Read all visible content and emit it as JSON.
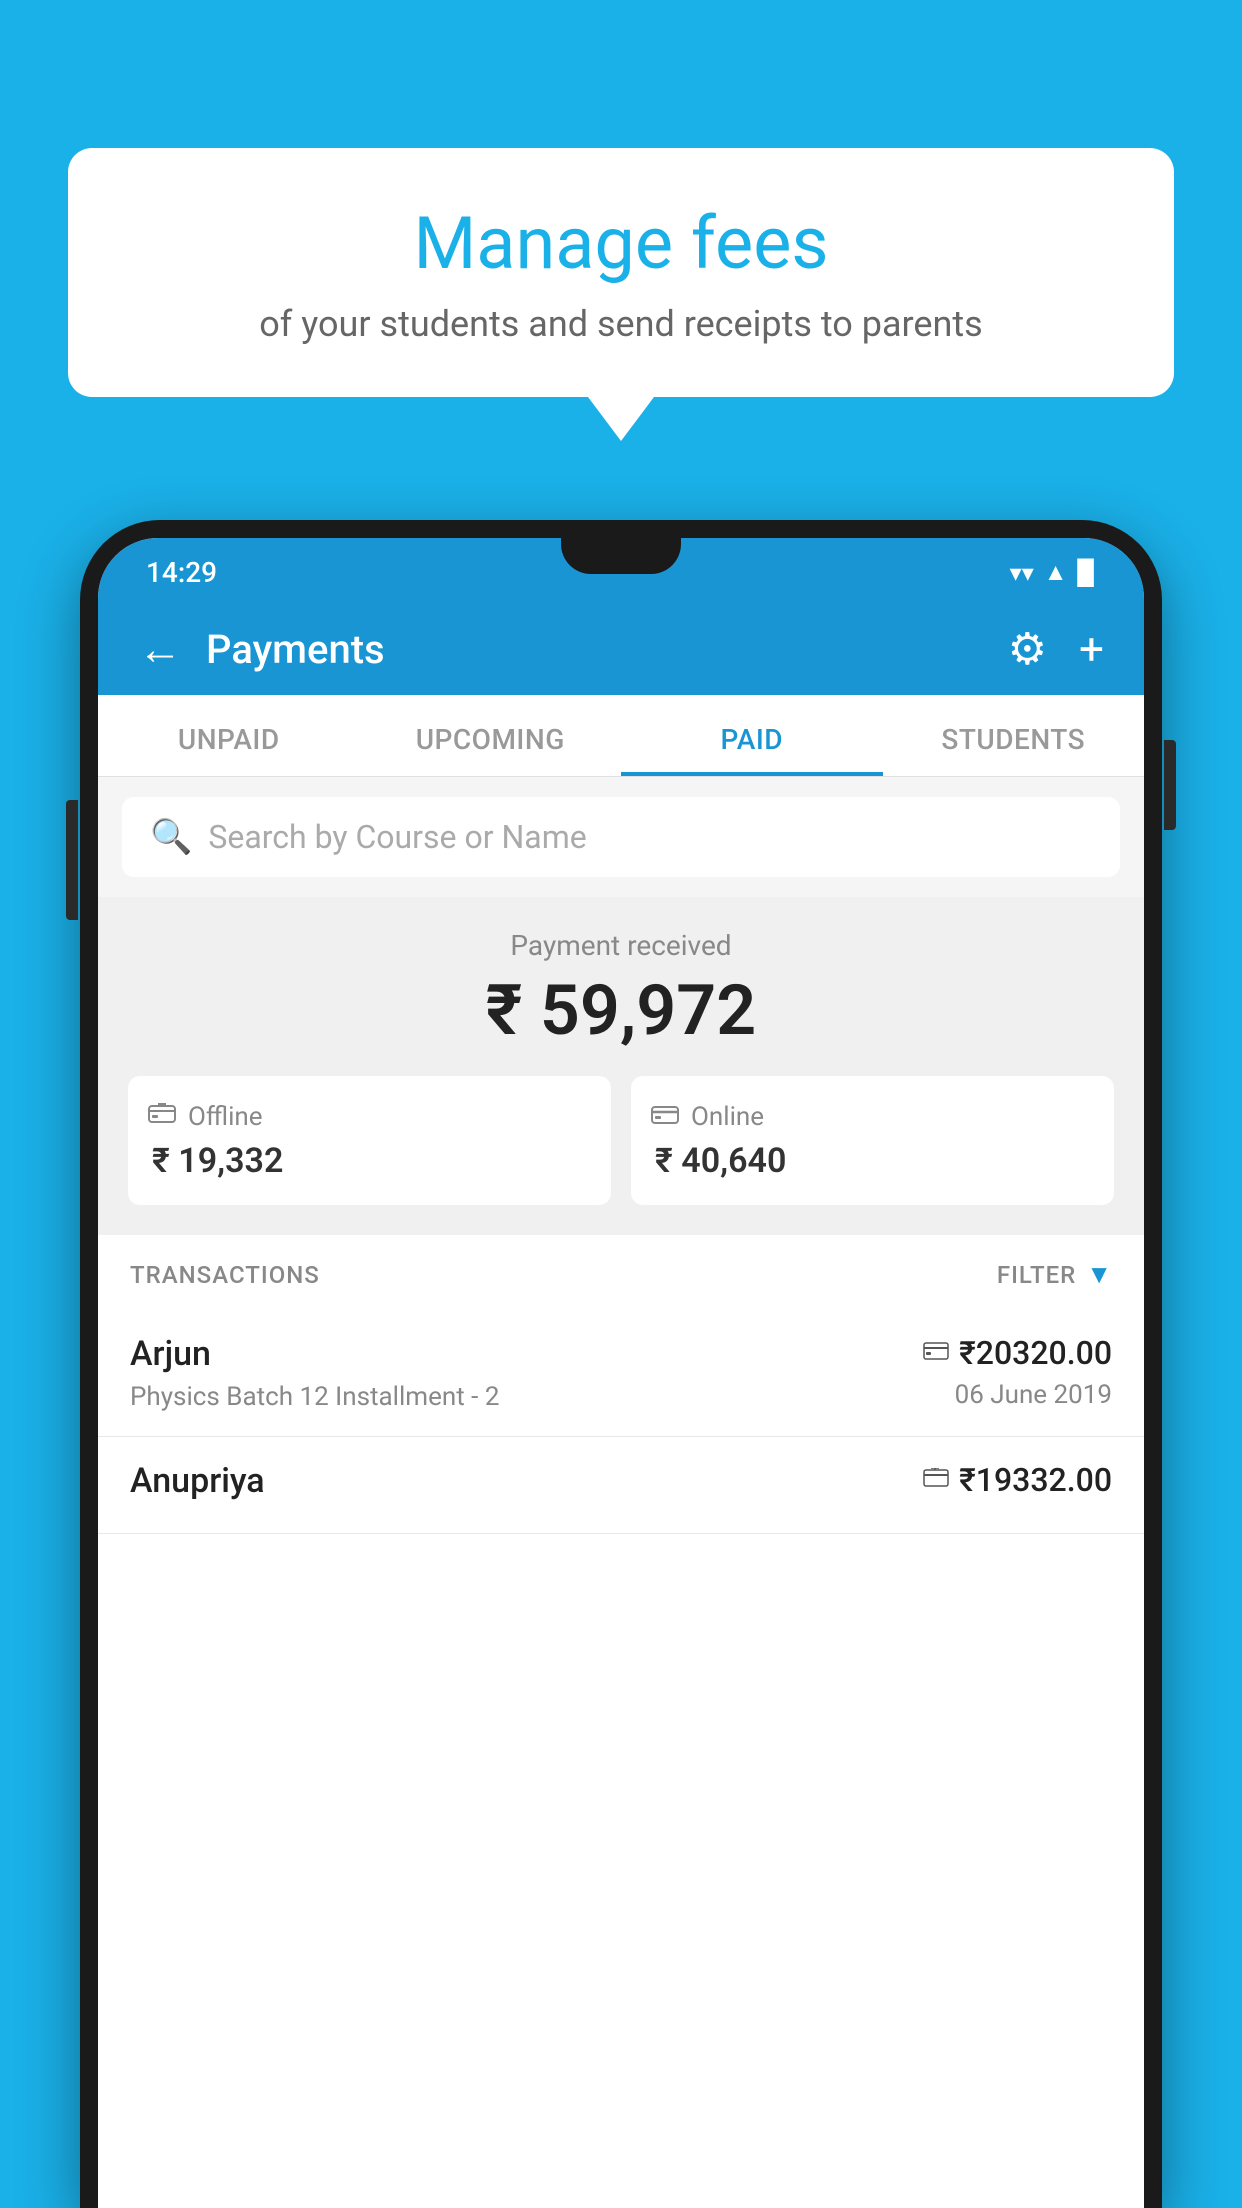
{
  "background_color": "#1ab0e8",
  "speech_bubble": {
    "title": "Manage fees",
    "subtitle": "of your students and send receipts to parents"
  },
  "status_bar": {
    "time": "14:29",
    "wifi": "▼",
    "signal": "▲",
    "battery": "▌"
  },
  "app_header": {
    "title": "Payments",
    "back_label": "←",
    "gear_label": "⚙",
    "plus_label": "+"
  },
  "tabs": [
    {
      "label": "UNPAID",
      "active": false
    },
    {
      "label": "UPCOMING",
      "active": false
    },
    {
      "label": "PAID",
      "active": true
    },
    {
      "label": "STUDENTS",
      "active": false
    }
  ],
  "search": {
    "placeholder": "Search by Course or Name"
  },
  "payment_received": {
    "label": "Payment received",
    "amount": "₹ 59,972",
    "offline": {
      "icon": "💳",
      "label": "Offline",
      "amount": "₹ 19,332"
    },
    "online": {
      "icon": "💳",
      "label": "Online",
      "amount": "₹ 40,640"
    }
  },
  "transactions": {
    "header_label": "TRANSACTIONS",
    "filter_label": "FILTER",
    "rows": [
      {
        "name": "Arjun",
        "detail": "Physics Batch 12 Installment - 2",
        "payment_type": "online",
        "amount": "₹20320.00",
        "date": "06 June 2019"
      },
      {
        "name": "Anupriya",
        "detail": "",
        "payment_type": "offline",
        "amount": "₹19332.00",
        "date": ""
      }
    ]
  }
}
